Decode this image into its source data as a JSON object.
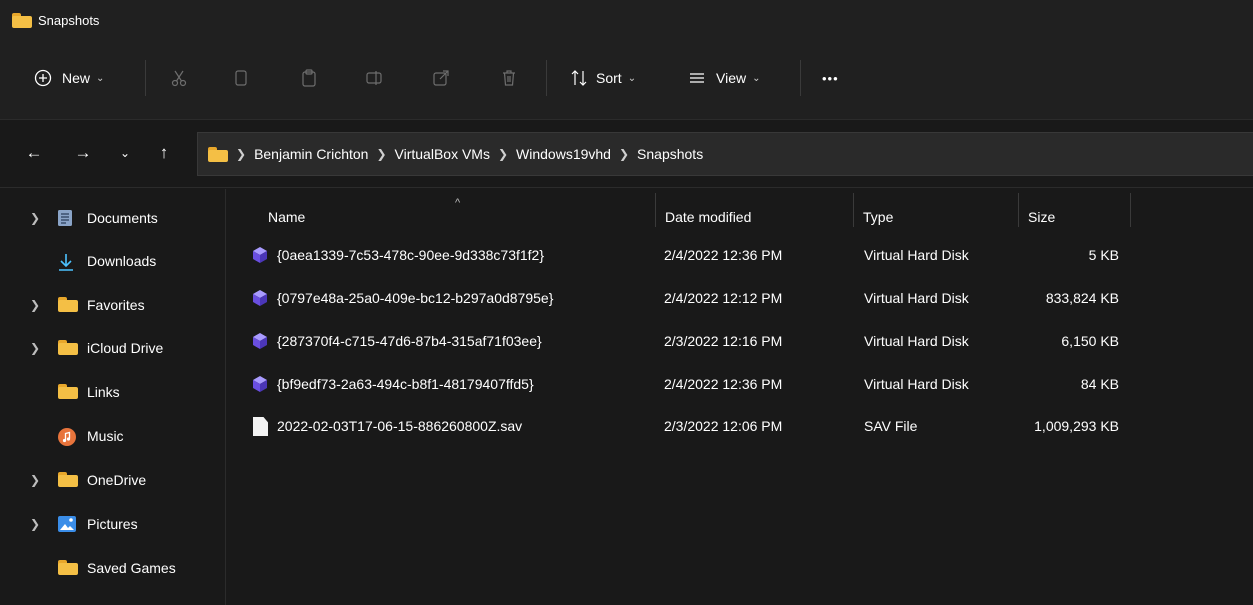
{
  "window": {
    "title": "Snapshots"
  },
  "toolbar": {
    "new_label": "New",
    "sort_label": "Sort",
    "view_label": "View",
    "more_label": "•••"
  },
  "address": {
    "crumbs": [
      "Benjamin Crichton",
      "VirtualBox VMs",
      "Windows19vhd",
      "Snapshots"
    ]
  },
  "sidebar": {
    "items": [
      {
        "label": "Documents",
        "icon": "documents-icon"
      },
      {
        "label": "Downloads",
        "icon": "download-arrow-icon"
      },
      {
        "label": "Favorites",
        "icon": "folder-icon"
      },
      {
        "label": "iCloud Drive",
        "icon": "folder-icon"
      },
      {
        "label": "Links",
        "icon": "folder-icon"
      },
      {
        "label": "Music",
        "icon": "music-icon"
      },
      {
        "label": "OneDrive",
        "icon": "folder-icon"
      },
      {
        "label": "Pictures",
        "icon": "pictures-icon"
      },
      {
        "label": "Saved Games",
        "icon": "folder-icon"
      }
    ]
  },
  "columns": {
    "name": "Name",
    "date": "Date modified",
    "type": "Type",
    "size": "Size"
  },
  "files": [
    {
      "name": "{0aea1339-7c53-478c-90ee-9d338c73f1f2}",
      "date": "2/4/2022 12:36 PM",
      "type": "Virtual Hard Disk",
      "size": "5 KB",
      "icon": "virtual-disk-icon"
    },
    {
      "name": "{0797e48a-25a0-409e-bc12-b297a0d8795e}",
      "date": "2/4/2022 12:12 PM",
      "type": "Virtual Hard Disk",
      "size": "833,824 KB",
      "icon": "virtual-disk-icon"
    },
    {
      "name": "{287370f4-c715-47d6-87b4-315af71f03ee}",
      "date": "2/3/2022 12:16 PM",
      "type": "Virtual Hard Disk",
      "size": "6,150 KB",
      "icon": "virtual-disk-icon"
    },
    {
      "name": "{bf9edf73-2a63-494c-b8f1-48179407ffd5}",
      "date": "2/4/2022 12:36 PM",
      "type": "Virtual Hard Disk",
      "size": "84 KB",
      "icon": "virtual-disk-icon"
    },
    {
      "name": "2022-02-03T17-06-15-886260800Z.sav",
      "date": "2/3/2022 12:06 PM",
      "type": "SAV File",
      "size": "1,009,293 KB",
      "icon": "file-icon"
    }
  ],
  "colors": {
    "folder": "#f4bf45",
    "disk": "#7b61ff",
    "background": "#191919"
  }
}
